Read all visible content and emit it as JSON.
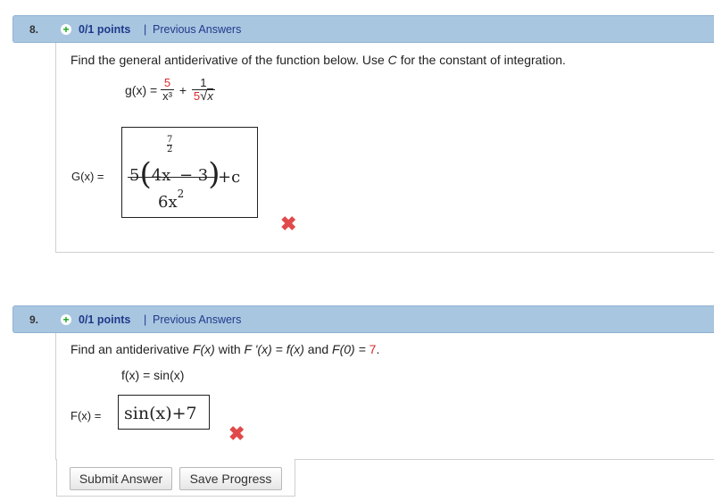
{
  "questions": [
    {
      "number": "8.",
      "points": "0/1 points",
      "separator": "|",
      "previous_answers": "Previous Answers",
      "prompt": "Find the general antiderivative of the function below. Use",
      "prompt_var": "C",
      "prompt_end": "for the constant of integration.",
      "given_lhs": "g(x) =",
      "given_term1_num": "5",
      "given_term1_den": "x³",
      "given_plus": "+",
      "given_term2_num": "1",
      "given_term2_den_coef": "5",
      "given_term2_den_radicand": "x",
      "answer_label": "G(x) =",
      "answer_num": "5(4x^(7/2) − 3)",
      "answer_num_prefix": "5",
      "answer_num_inner": "4x",
      "answer_exp_num": "7",
      "answer_exp_den": "2",
      "answer_num_minus": "− 3",
      "answer_den_base": "6x",
      "answer_den_exp": "2",
      "answer_plus_c": "+c",
      "status": "incorrect"
    },
    {
      "number": "9.",
      "points": "0/1 points",
      "separator": "|",
      "previous_answers": "Previous Answers",
      "prompt_a": "Find an antiderivative",
      "prompt_F": "F(x)",
      "prompt_b": "with",
      "prompt_Fp": "F '(x) = f(x)",
      "prompt_c": "and",
      "prompt_F0": "F(0) =",
      "prompt_val": "7",
      "given": "f(x) = sin(x)",
      "answer_label": "F(x) =",
      "answer_value": "sin(x)+7",
      "status": "incorrect"
    }
  ],
  "buttons": {
    "submit": "Submit Answer",
    "save": "Save Progress"
  },
  "icons": {
    "points_badge": "plus-circle-icon",
    "incorrect": "x-mark-icon"
  },
  "colors": {
    "header_bg": "#a9c6e1",
    "link": "#1f3a8a",
    "incorrect": "#e04a4a",
    "highlight": "#d62b2b"
  }
}
